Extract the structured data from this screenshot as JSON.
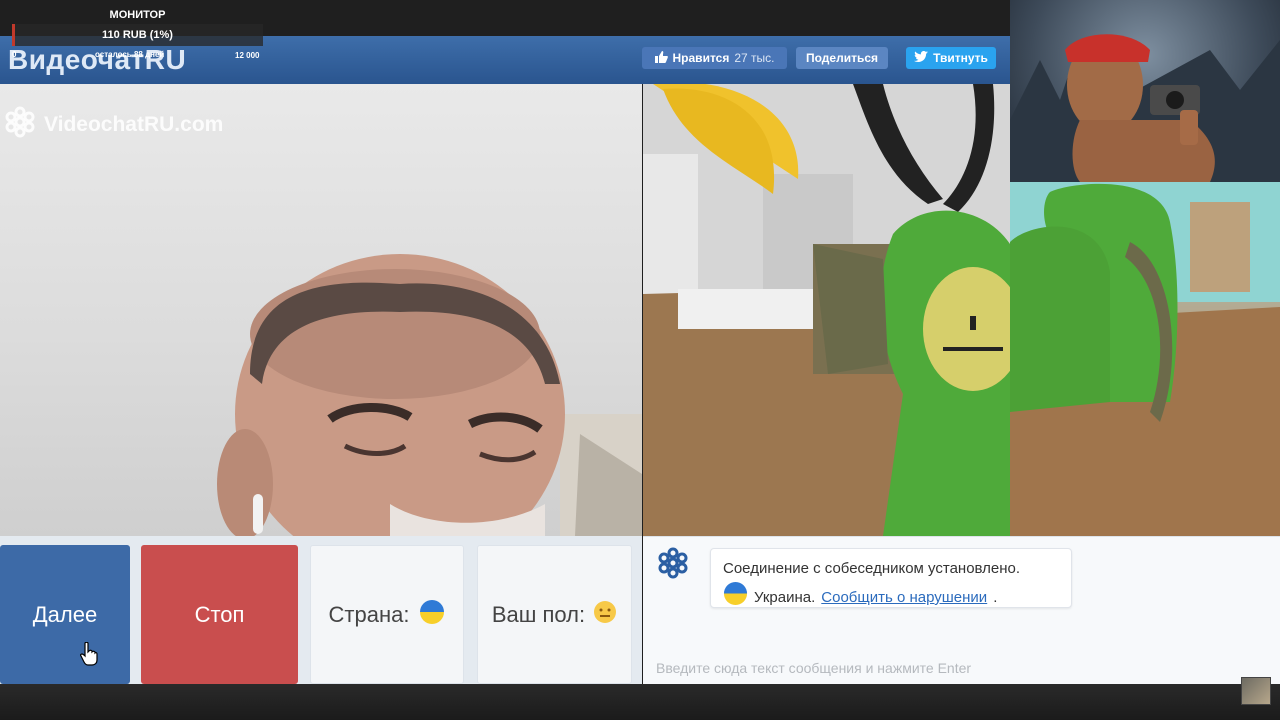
{
  "overlay": {
    "title": "МОНИТОР",
    "amount": "110 RUB (1%)",
    "progress_fraction": 0.01,
    "start": "0",
    "days_left": "осталось 88 дней",
    "goal": "12 000"
  },
  "header": {
    "logo": "ВидеочатRU",
    "like_label": "Нравится",
    "like_count": "27 тыс.",
    "share_label": "Поделиться",
    "tweet_label": "Твитнуть"
  },
  "video": {
    "watermark": "VideochatRU.com"
  },
  "controls": {
    "next_label": "Далее",
    "stop_label": "Стоп",
    "country_label": "Страна:",
    "gender_label": "Ваш пол:"
  },
  "chat": {
    "connected_msg": "Соединение с собеседником установлено.",
    "country_name": "Украина.",
    "report_link": "Сообщить о нарушении",
    "trailing": ".",
    "input_placeholder": "Введите сюда текст сообщения и нажмите Enter"
  },
  "colors": {
    "header_blue": "#2a558f",
    "next_blue": "#3d6aa7",
    "stop_red": "#c94e4e",
    "link_blue": "#2b6bbd"
  }
}
